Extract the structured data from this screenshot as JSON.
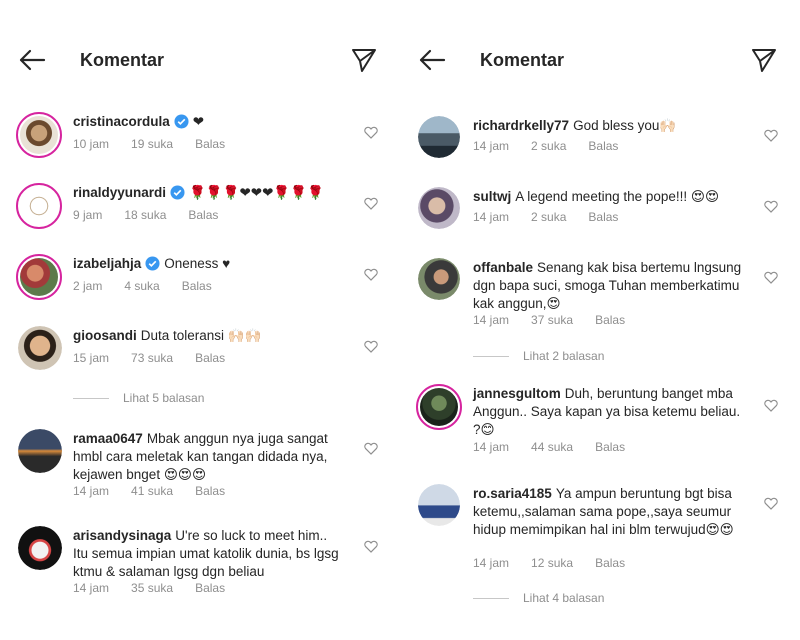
{
  "left": {
    "header": {
      "title": "Komentar"
    },
    "comments": [
      {
        "username": "cristinacordula",
        "text": "❤",
        "time": "10 jam",
        "likes": "19 suka",
        "reply": "Balas"
      },
      {
        "username": "rinaldyyunardi",
        "text": "🌹🌹🌹❤❤❤🌹🌹🌹",
        "time": "9 jam",
        "likes": "18 suka",
        "reply": "Balas"
      },
      {
        "username": "izabeljahja",
        "text": "Oneness ♥",
        "time": "2 jam",
        "likes": "4 suka",
        "reply": "Balas"
      },
      {
        "username": "gioosandi",
        "text": "Duta toleransi 🙌🏻🙌🏻",
        "time": "15 jam",
        "likes": "73 suka",
        "reply": "Balas"
      },
      {
        "username": "ramaa0647",
        "text": "Mbak anggun nya juga sangat hmbl cara meletak kan tangan didada nya, kejawen bnget 😍😍😍",
        "time": "14 jam",
        "likes": "41 suka",
        "reply": "Balas"
      },
      {
        "username": "arisandysinaga",
        "text": "U're so luck to meet him.. Itu semua impian umat katolik dunia, bs lgsg ktmu & salaman lgsg dgn beliau",
        "time": "14 jam",
        "likes": "35 suka",
        "reply": "Balas"
      }
    ],
    "view_replies": "Lihat 5 balasan"
  },
  "right": {
    "header": {
      "title": "Komentar"
    },
    "comments": [
      {
        "username": "richardrkelly77",
        "text": "God bless you🙌🏻",
        "time": "14 jam",
        "likes": "2 suka",
        "reply": "Balas"
      },
      {
        "username": "sultwj",
        "text": "A legend meeting the pope!!! 😍😍",
        "time": "14 jam",
        "likes": "2 suka",
        "reply": "Balas"
      },
      {
        "username": "offanbale",
        "text": "Senang kak bisa bertemu lngsung dgn bapa suci, smoga Tuhan memberkatimu kak anggun,😍",
        "time": "14 jam",
        "likes": "37 suka",
        "reply": "Balas"
      },
      {
        "username": "jannesgultom",
        "text": "Duh, beruntung banget mba Anggun.. Saya kapan ya bisa ketemu beliau. ?😊",
        "time": "14 jam",
        "likes": "44 suka",
        "reply": "Balas"
      },
      {
        "username": "ro.saria4185",
        "text": "Ya ampun beruntung bgt bisa ketemu,,salaman sama pope,,saya seumur hidup memimpikan hal ini blm terwujud😍😍",
        "time": "14 jam",
        "likes": "12 suka",
        "reply": "Balas"
      }
    ],
    "view_replies_1": "Lihat 2 balasan",
    "view_replies_2": "Lihat 4 balasan"
  },
  "icons": {
    "back": "arrow-left-icon",
    "send": "paper-plane-icon",
    "like": "heart-outline-icon",
    "verified": "verified-badge-icon"
  },
  "colors": {
    "verified": "#3897f0",
    "story_ring": "#d6249f",
    "muted": "#8e8e8e"
  }
}
